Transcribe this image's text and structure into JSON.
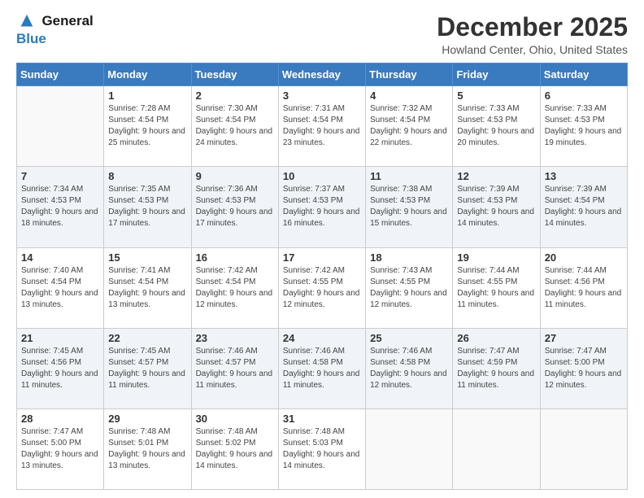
{
  "header": {
    "logo_line1": "General",
    "logo_line2": "Blue",
    "month_title": "December 2025",
    "location": "Howland Center, Ohio, United States"
  },
  "days_of_week": [
    "Sunday",
    "Monday",
    "Tuesday",
    "Wednesday",
    "Thursday",
    "Friday",
    "Saturday"
  ],
  "weeks": [
    [
      {
        "day": "",
        "sunrise": "",
        "sunset": "",
        "daylight": ""
      },
      {
        "day": "1",
        "sunrise": "Sunrise: 7:28 AM",
        "sunset": "Sunset: 4:54 PM",
        "daylight": "Daylight: 9 hours and 25 minutes."
      },
      {
        "day": "2",
        "sunrise": "Sunrise: 7:30 AM",
        "sunset": "Sunset: 4:54 PM",
        "daylight": "Daylight: 9 hours and 24 minutes."
      },
      {
        "day": "3",
        "sunrise": "Sunrise: 7:31 AM",
        "sunset": "Sunset: 4:54 PM",
        "daylight": "Daylight: 9 hours and 23 minutes."
      },
      {
        "day": "4",
        "sunrise": "Sunrise: 7:32 AM",
        "sunset": "Sunset: 4:54 PM",
        "daylight": "Daylight: 9 hours and 22 minutes."
      },
      {
        "day": "5",
        "sunrise": "Sunrise: 7:33 AM",
        "sunset": "Sunset: 4:53 PM",
        "daylight": "Daylight: 9 hours and 20 minutes."
      },
      {
        "day": "6",
        "sunrise": "Sunrise: 7:33 AM",
        "sunset": "Sunset: 4:53 PM",
        "daylight": "Daylight: 9 hours and 19 minutes."
      }
    ],
    [
      {
        "day": "7",
        "sunrise": "Sunrise: 7:34 AM",
        "sunset": "Sunset: 4:53 PM",
        "daylight": "Daylight: 9 hours and 18 minutes."
      },
      {
        "day": "8",
        "sunrise": "Sunrise: 7:35 AM",
        "sunset": "Sunset: 4:53 PM",
        "daylight": "Daylight: 9 hours and 17 minutes."
      },
      {
        "day": "9",
        "sunrise": "Sunrise: 7:36 AM",
        "sunset": "Sunset: 4:53 PM",
        "daylight": "Daylight: 9 hours and 17 minutes."
      },
      {
        "day": "10",
        "sunrise": "Sunrise: 7:37 AM",
        "sunset": "Sunset: 4:53 PM",
        "daylight": "Daylight: 9 hours and 16 minutes."
      },
      {
        "day": "11",
        "sunrise": "Sunrise: 7:38 AM",
        "sunset": "Sunset: 4:53 PM",
        "daylight": "Daylight: 9 hours and 15 minutes."
      },
      {
        "day": "12",
        "sunrise": "Sunrise: 7:39 AM",
        "sunset": "Sunset: 4:53 PM",
        "daylight": "Daylight: 9 hours and 14 minutes."
      },
      {
        "day": "13",
        "sunrise": "Sunrise: 7:39 AM",
        "sunset": "Sunset: 4:54 PM",
        "daylight": "Daylight: 9 hours and 14 minutes."
      }
    ],
    [
      {
        "day": "14",
        "sunrise": "Sunrise: 7:40 AM",
        "sunset": "Sunset: 4:54 PM",
        "daylight": "Daylight: 9 hours and 13 minutes."
      },
      {
        "day": "15",
        "sunrise": "Sunrise: 7:41 AM",
        "sunset": "Sunset: 4:54 PM",
        "daylight": "Daylight: 9 hours and 13 minutes."
      },
      {
        "day": "16",
        "sunrise": "Sunrise: 7:42 AM",
        "sunset": "Sunset: 4:54 PM",
        "daylight": "Daylight: 9 hours and 12 minutes."
      },
      {
        "day": "17",
        "sunrise": "Sunrise: 7:42 AM",
        "sunset": "Sunset: 4:55 PM",
        "daylight": "Daylight: 9 hours and 12 minutes."
      },
      {
        "day": "18",
        "sunrise": "Sunrise: 7:43 AM",
        "sunset": "Sunset: 4:55 PM",
        "daylight": "Daylight: 9 hours and 12 minutes."
      },
      {
        "day": "19",
        "sunrise": "Sunrise: 7:44 AM",
        "sunset": "Sunset: 4:55 PM",
        "daylight": "Daylight: 9 hours and 11 minutes."
      },
      {
        "day": "20",
        "sunrise": "Sunrise: 7:44 AM",
        "sunset": "Sunset: 4:56 PM",
        "daylight": "Daylight: 9 hours and 11 minutes."
      }
    ],
    [
      {
        "day": "21",
        "sunrise": "Sunrise: 7:45 AM",
        "sunset": "Sunset: 4:56 PM",
        "daylight": "Daylight: 9 hours and 11 minutes."
      },
      {
        "day": "22",
        "sunrise": "Sunrise: 7:45 AM",
        "sunset": "Sunset: 4:57 PM",
        "daylight": "Daylight: 9 hours and 11 minutes."
      },
      {
        "day": "23",
        "sunrise": "Sunrise: 7:46 AM",
        "sunset": "Sunset: 4:57 PM",
        "daylight": "Daylight: 9 hours and 11 minutes."
      },
      {
        "day": "24",
        "sunrise": "Sunrise: 7:46 AM",
        "sunset": "Sunset: 4:58 PM",
        "daylight": "Daylight: 9 hours and 11 minutes."
      },
      {
        "day": "25",
        "sunrise": "Sunrise: 7:46 AM",
        "sunset": "Sunset: 4:58 PM",
        "daylight": "Daylight: 9 hours and 12 minutes."
      },
      {
        "day": "26",
        "sunrise": "Sunrise: 7:47 AM",
        "sunset": "Sunset: 4:59 PM",
        "daylight": "Daylight: 9 hours and 11 minutes."
      },
      {
        "day": "27",
        "sunrise": "Sunrise: 7:47 AM",
        "sunset": "Sunset: 5:00 PM",
        "daylight": "Daylight: 9 hours and 12 minutes."
      }
    ],
    [
      {
        "day": "28",
        "sunrise": "Sunrise: 7:47 AM",
        "sunset": "Sunset: 5:00 PM",
        "daylight": "Daylight: 9 hours and 13 minutes."
      },
      {
        "day": "29",
        "sunrise": "Sunrise: 7:48 AM",
        "sunset": "Sunset: 5:01 PM",
        "daylight": "Daylight: 9 hours and 13 minutes."
      },
      {
        "day": "30",
        "sunrise": "Sunrise: 7:48 AM",
        "sunset": "Sunset: 5:02 PM",
        "daylight": "Daylight: 9 hours and 14 minutes."
      },
      {
        "day": "31",
        "sunrise": "Sunrise: 7:48 AM",
        "sunset": "Sunset: 5:03 PM",
        "daylight": "Daylight: 9 hours and 14 minutes."
      },
      {
        "day": "",
        "sunrise": "",
        "sunset": "",
        "daylight": ""
      },
      {
        "day": "",
        "sunrise": "",
        "sunset": "",
        "daylight": ""
      },
      {
        "day": "",
        "sunrise": "",
        "sunset": "",
        "daylight": ""
      }
    ]
  ]
}
